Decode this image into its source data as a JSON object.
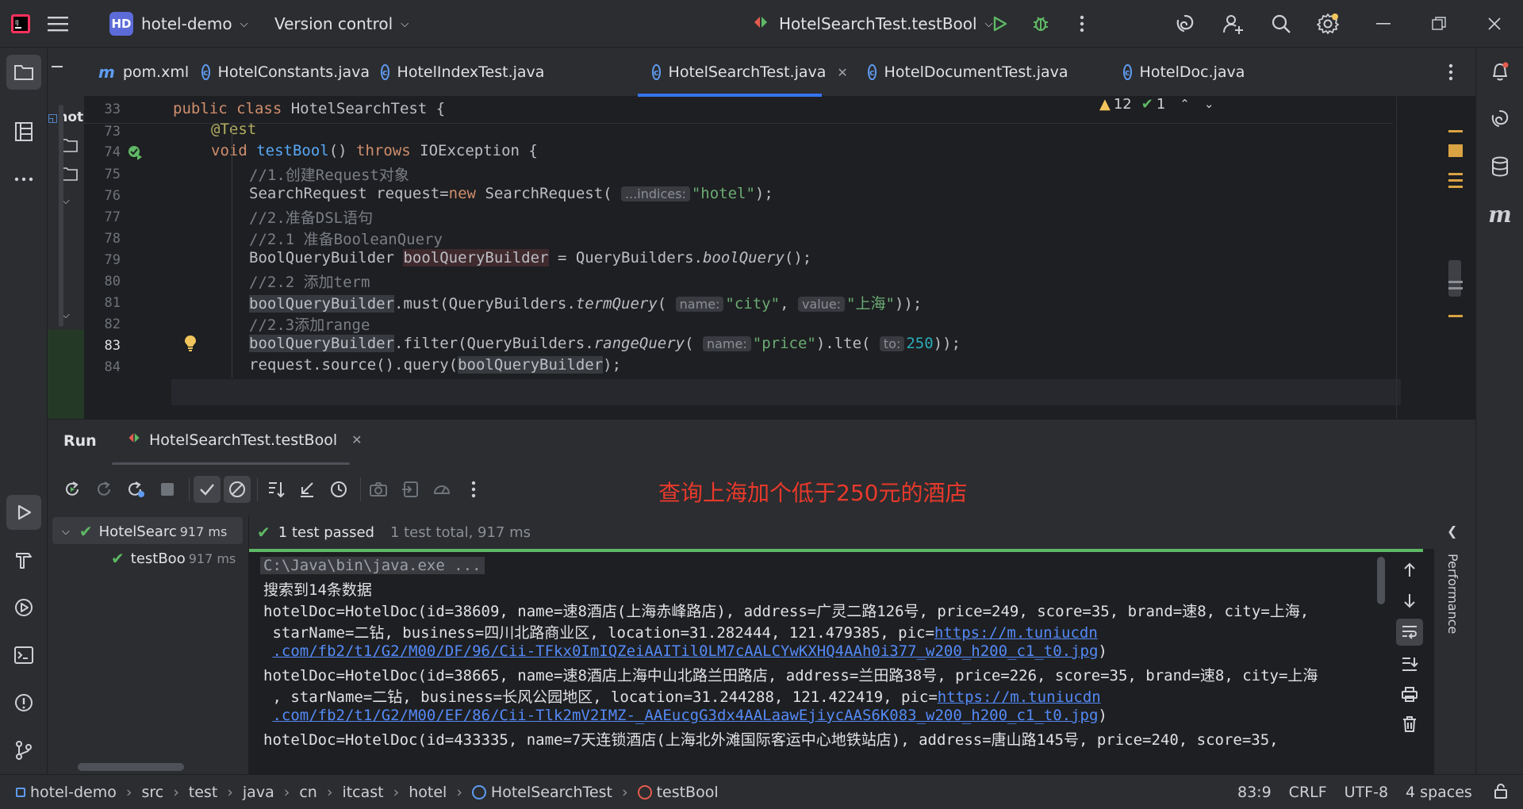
{
  "titlebar": {
    "project_badge": "HD",
    "project_name": "hotel-demo",
    "vcs_label": "Version control",
    "run_config": "HotelSearchTest.testBool"
  },
  "tabs": [
    {
      "label": "pom.xml",
      "icon": "m-icon"
    },
    {
      "label": "HotelConstants.java",
      "icon": "class-icon"
    },
    {
      "label": "HotelIndexTest.java",
      "icon": "class-icon"
    },
    {
      "label": "HotelSearchTest.java",
      "icon": "class-icon",
      "active": true
    },
    {
      "label": "HotelDocumentTest.java",
      "icon": "class-icon"
    },
    {
      "label": "HotelDoc.java",
      "icon": "class-icon"
    }
  ],
  "project_panel": {
    "label": "hot"
  },
  "editor": {
    "sticky_line_no": "33",
    "warnings_count": "12",
    "checks_count": "1",
    "lines": [
      {
        "no": "33",
        "text": "public class HotelSearchTest {"
      },
      {
        "no": "73",
        "text": "@Test"
      },
      {
        "no": "74",
        "text": "void testBool() throws IOException {"
      },
      {
        "no": "75",
        "text": "//1.创建Request对象"
      },
      {
        "no": "76",
        "text": "SearchRequest request=new SearchRequest( ...indices: \"hotel\");"
      },
      {
        "no": "77",
        "text": "//2.准备DSL语句"
      },
      {
        "no": "78",
        "text": "//2.1 准备BooleanQuery"
      },
      {
        "no": "79",
        "text": "BoolQueryBuilder boolQueryBuilder = QueryBuilders.boolQuery();"
      },
      {
        "no": "80",
        "text": "//2.2 添加term"
      },
      {
        "no": "81",
        "text": "boolQueryBuilder.must(QueryBuilders.termQuery( name: \"city\", value: \"上海\"));"
      },
      {
        "no": "82",
        "text": "//2.3添加range"
      },
      {
        "no": "83",
        "text": "boolQueryBuilder.filter(QueryBuilders.rangeQuery( name: \"price\").lte( to: 250));"
      },
      {
        "no": "84",
        "text": "request.source().query(boolQueryBuilder);"
      }
    ],
    "hints": {
      "indices": "...indices:",
      "name": "name:",
      "value": "value:",
      "to": "to:"
    }
  },
  "run": {
    "title": "Run",
    "config_tab": "HotelSearchTest.testBool",
    "annotation": "查询上海加个低于250元的酒店",
    "tree": [
      {
        "label": "HotelSearc",
        "time": "917 ms"
      },
      {
        "label": "testBoo",
        "time": "917 ms"
      }
    ],
    "result_status": "1 test passed",
    "result_summary": "1 test total, 917 ms",
    "console": [
      "C:\\Java\\bin\\java.exe ...",
      "搜索到14条数据",
      "hotelDoc=HotelDoc(id=38609, name=速8酒店(上海赤峰路店), address=广灵二路126号, price=249, score=35, brand=速8, city=上海,",
      " starName=二钻, business=四川北路商业区, location=31.282444, 121.479385, pic=",
      "https://m.tuniucdn",
      ".com/fb2/t1/G2/M00/DF/96/Cii-TFkx0ImIQZeiAAITil0LM7cAALCYwKXHQ4AAh0i377_w200_h200_c1_t0.jpg",
      ")",
      "hotelDoc=HotelDoc(id=38665, name=速8酒店上海中山北路兰田路店, address=兰田路38号, price=226, score=35, brand=速8, city=上海",
      ", starName=二钻, business=长风公园地区, location=31.244288, 121.422419, pic=",
      "https://m.tuniucdn",
      ".com/fb2/t1/G2/M00/EF/86/Cii-Tlk2mV2IMZ-_AAEucgG3dx4AALaawEjiycAAS6K083_w200_h200_c1_t0.jpg",
      ")",
      "hotelDoc=HotelDoc(id=433335, name=7天连锁酒店(上海北外滩国际客运中心地铁站店), address=唐山路145号, price=240, score=35,"
    ],
    "side_label": "Performance"
  },
  "statusbar": {
    "breadcrumb": [
      "hotel-demo",
      "src",
      "test",
      "java",
      "cn",
      "itcast",
      "hotel",
      "HotelSearchTest",
      "testBool"
    ],
    "position": "83:9",
    "line_sep": "CRLF",
    "encoding": "UTF-8",
    "indent": "4 spaces"
  },
  "colors": {
    "accent": "#3574f0",
    "pass_green": "#5fb865",
    "annotation_red": "#e8392b"
  }
}
